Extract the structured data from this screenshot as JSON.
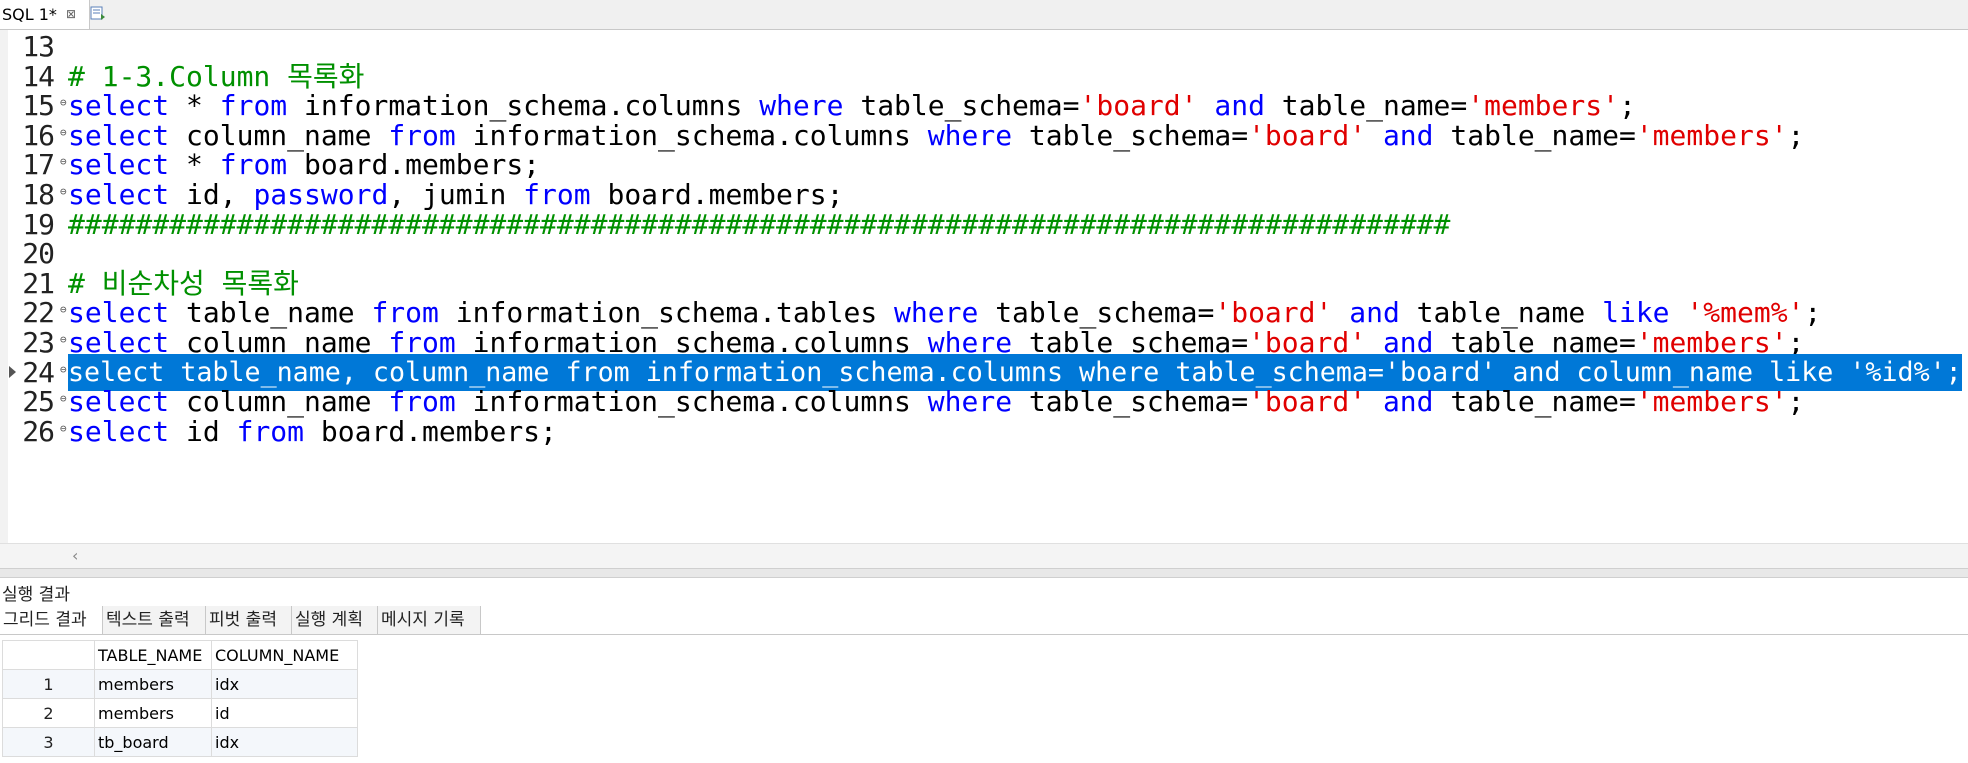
{
  "tab": {
    "title": "SQL 1*",
    "close": "⊠"
  },
  "editor": {
    "lines": [
      {
        "num": "13",
        "tokens": []
      },
      {
        "num": "14",
        "tokens": [
          {
            "t": "# 1-3.Column 목록화",
            "c": "cm"
          }
        ]
      },
      {
        "num": "15",
        "tokens": [
          {
            "t": "select",
            "c": "kw"
          },
          {
            "t": " * ",
            "c": ""
          },
          {
            "t": "from",
            "c": "kw"
          },
          {
            "t": " information_schema.columns ",
            "c": ""
          },
          {
            "t": "where",
            "c": "kw"
          },
          {
            "t": " table_schema=",
            "c": ""
          },
          {
            "t": "'board'",
            "c": "str"
          },
          {
            "t": " ",
            "c": ""
          },
          {
            "t": "and",
            "c": "kw"
          },
          {
            "t": " table_name=",
            "c": ""
          },
          {
            "t": "'members'",
            "c": "str"
          },
          {
            "t": ";",
            "c": ""
          }
        ]
      },
      {
        "num": "16",
        "tokens": [
          {
            "t": "select",
            "c": "kw"
          },
          {
            "t": " column_name ",
            "c": ""
          },
          {
            "t": "from",
            "c": "kw"
          },
          {
            "t": " information_schema.columns ",
            "c": ""
          },
          {
            "t": "where",
            "c": "kw"
          },
          {
            "t": " table_schema=",
            "c": ""
          },
          {
            "t": "'board'",
            "c": "str"
          },
          {
            "t": " ",
            "c": ""
          },
          {
            "t": "and",
            "c": "kw"
          },
          {
            "t": " table_name=",
            "c": ""
          },
          {
            "t": "'members'",
            "c": "str"
          },
          {
            "t": ";",
            "c": ""
          }
        ]
      },
      {
        "num": "17",
        "tokens": [
          {
            "t": "select",
            "c": "kw"
          },
          {
            "t": " * ",
            "c": ""
          },
          {
            "t": "from",
            "c": "kw"
          },
          {
            "t": " board.members;",
            "c": ""
          }
        ]
      },
      {
        "num": "18",
        "tokens": [
          {
            "t": "select",
            "c": "kw"
          },
          {
            "t": " id, ",
            "c": ""
          },
          {
            "t": "password",
            "c": "kw"
          },
          {
            "t": ", jumin ",
            "c": ""
          },
          {
            "t": "from",
            "c": "kw"
          },
          {
            "t": " board.members;",
            "c": ""
          }
        ]
      },
      {
        "num": "19",
        "tokens": [
          {
            "t": "##################################################################################",
            "c": "cm"
          }
        ]
      },
      {
        "num": "20",
        "tokens": []
      },
      {
        "num": "21",
        "tokens": [
          {
            "t": "# 비순차성 목록화",
            "c": "cm"
          }
        ]
      },
      {
        "num": "22",
        "tokens": [
          {
            "t": "select",
            "c": "kw"
          },
          {
            "t": " table_name ",
            "c": ""
          },
          {
            "t": "from",
            "c": "kw"
          },
          {
            "t": " information_schema.tables ",
            "c": ""
          },
          {
            "t": "where",
            "c": "kw"
          },
          {
            "t": " table_schema=",
            "c": ""
          },
          {
            "t": "'board'",
            "c": "str"
          },
          {
            "t": " ",
            "c": ""
          },
          {
            "t": "and",
            "c": "kw"
          },
          {
            "t": " table_name ",
            "c": ""
          },
          {
            "t": "like",
            "c": "kw"
          },
          {
            "t": " ",
            "c": ""
          },
          {
            "t": "'%mem%'",
            "c": "str"
          },
          {
            "t": ";",
            "c": ""
          }
        ]
      },
      {
        "num": "23",
        "tokens": [
          {
            "t": "select",
            "c": "kw"
          },
          {
            "t": " column_name ",
            "c": ""
          },
          {
            "t": "from",
            "c": "kw"
          },
          {
            "t": " information_schema.columns ",
            "c": ""
          },
          {
            "t": "where",
            "c": "kw"
          },
          {
            "t": " table_schema=",
            "c": ""
          },
          {
            "t": "'board'",
            "c": "str"
          },
          {
            "t": " ",
            "c": ""
          },
          {
            "t": "and",
            "c": "kw"
          },
          {
            "t": " table_name=",
            "c": ""
          },
          {
            "t": "'members'",
            "c": "str"
          },
          {
            "t": ";",
            "c": ""
          }
        ]
      },
      {
        "num": "24",
        "selected": true,
        "tokens": [
          {
            "t": "select table_name, column_name from information_schema.columns where table_schema='board' and column_name like '%id%';",
            "c": ""
          }
        ]
      },
      {
        "num": "25",
        "tokens": [
          {
            "t": "select",
            "c": "kw"
          },
          {
            "t": " column_name ",
            "c": ""
          },
          {
            "t": "from",
            "c": "kw"
          },
          {
            "t": " information_schema.columns ",
            "c": ""
          },
          {
            "t": "where",
            "c": "kw"
          },
          {
            "t": " table_schema=",
            "c": ""
          },
          {
            "t": "'board'",
            "c": "str"
          },
          {
            "t": " ",
            "c": ""
          },
          {
            "t": "and",
            "c": "kw"
          },
          {
            "t": " table_name=",
            "c": ""
          },
          {
            "t": "'members'",
            "c": "str"
          },
          {
            "t": ";",
            "c": ""
          }
        ]
      },
      {
        "num": "26",
        "tokens": [
          {
            "t": "select",
            "c": "kw"
          },
          {
            "t": " id ",
            "c": ""
          },
          {
            "t": "from",
            "c": "kw"
          },
          {
            "t": " board.members;",
            "c": ""
          }
        ]
      }
    ]
  },
  "results": {
    "title": "실행 결과",
    "tabs": [
      "그리드 결과",
      "텍스트 출력",
      "피벗 출력",
      "실행 계획",
      "메시지 기록"
    ],
    "columns": [
      "TABLE_NAME",
      "COLUMN_NAME"
    ],
    "rows": [
      {
        "num": "1",
        "cells": [
          "members",
          "idx"
        ]
      },
      {
        "num": "2",
        "cells": [
          "members",
          "id"
        ]
      },
      {
        "num": "3",
        "cells": [
          "tb_board",
          "idx"
        ]
      }
    ]
  },
  "colors": {
    "keyword": "#0000ff",
    "string": "#e00000",
    "comment": "#009000",
    "selection": "#0078d7"
  },
  "icons": [
    "close-icon",
    "new-tab-icon",
    "fold-marker-icon",
    "current-line-arrow-icon",
    "scroll-left-icon"
  ]
}
